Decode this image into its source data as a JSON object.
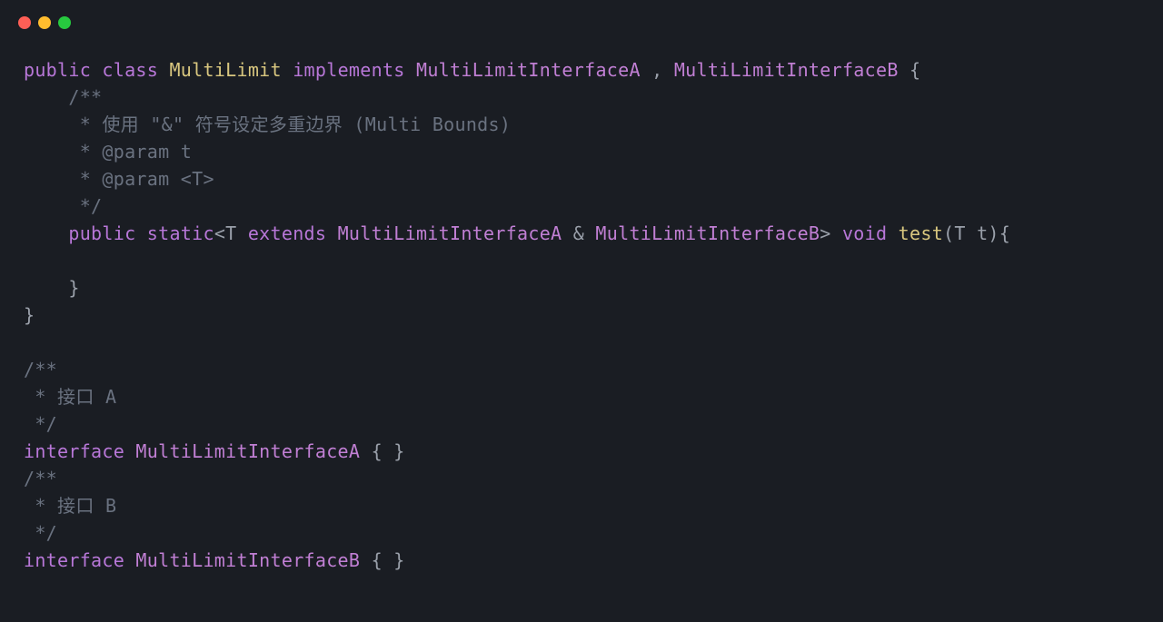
{
  "code": {
    "line1_public": "public",
    "line1_class": "class",
    "line1_name": "MultiLimit",
    "line1_implements": "implements",
    "line1_ifaceA": "MultiLimitInterfaceA",
    "line1_comma": " , ",
    "line1_ifaceB": "MultiLimitInterfaceB",
    "line1_brace": " {",
    "line2_comment": "    /**",
    "line3_comment": "     * 使用 \"&\" 符号设定多重边界 (Multi Bounds)",
    "line4_comment": "     * @param t",
    "line5_comment": "     * @param <T>",
    "line6_comment": "     */",
    "line7_indent": "    ",
    "line7_public": "public",
    "line7_static": "static",
    "line7_open": "<T ",
    "line7_extends": "extends",
    "line7_ifaceA": " MultiLimitInterfaceA ",
    "line7_amp": "&",
    "line7_ifaceB": " MultiLimitInterfaceB",
    "line7_close": "> ",
    "line7_void": "void",
    "line7_method": " test",
    "line7_params": "(T t){",
    "line8_blank": "",
    "line9_close": "    }",
    "line10_close": "}",
    "line11_blank": "",
    "line12_comment": "/**",
    "line13_comment": " * 接口 A",
    "line14_comment": " */",
    "line15_interface": "interface",
    "line15_name": " MultiLimitInterfaceA ",
    "line15_braces": "{ }",
    "line16_comment": "/**",
    "line17_comment": " * 接口 B",
    "line18_comment": " */",
    "line19_interface": "interface",
    "line19_name": " MultiLimitInterfaceB ",
    "line19_braces": "{ }"
  }
}
